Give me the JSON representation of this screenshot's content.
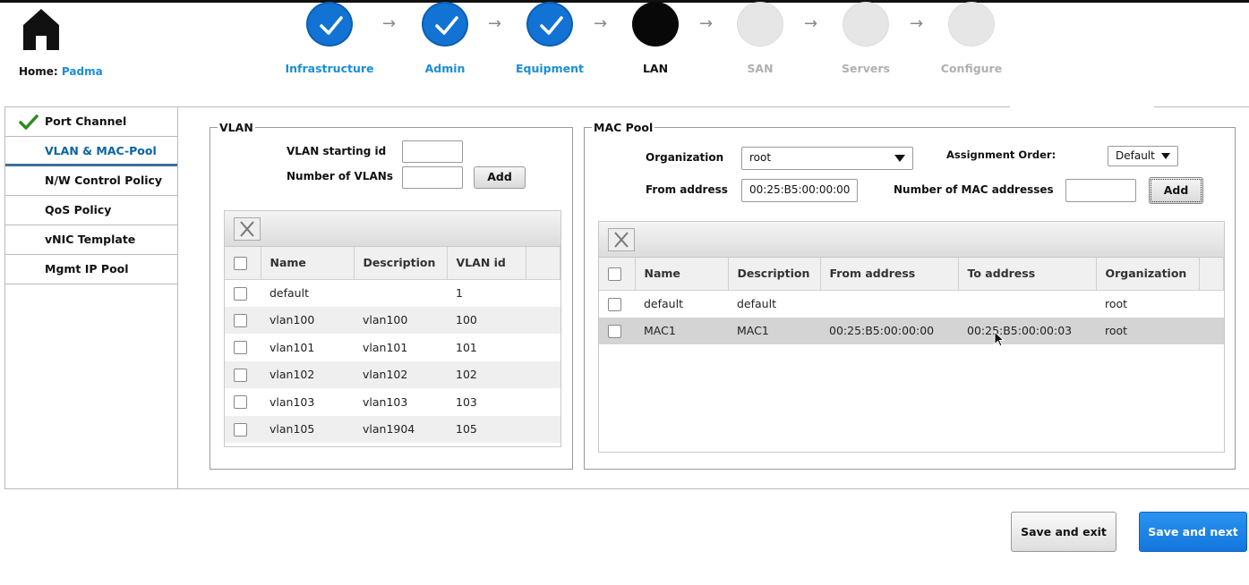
{
  "home": {
    "label": "Home:",
    "user": "Padma"
  },
  "steps": [
    {
      "label": "Infrastructure",
      "state": "done"
    },
    {
      "label": "Admin",
      "state": "done"
    },
    {
      "label": "Equipment",
      "state": "done"
    },
    {
      "label": "LAN",
      "state": "active"
    },
    {
      "label": "SAN",
      "state": "todo"
    },
    {
      "label": "Servers",
      "state": "todo"
    },
    {
      "label": "Configure",
      "state": "todo"
    }
  ],
  "sidebar": {
    "items": [
      {
        "label": "Port Channel",
        "checked": true
      },
      {
        "label": "VLAN & MAC-Pool",
        "selected": true
      },
      {
        "label": "N/W Control Policy"
      },
      {
        "label": "QoS Policy"
      },
      {
        "label": "vNIC Template"
      },
      {
        "label": "Mgmt IP Pool"
      }
    ]
  },
  "vlan": {
    "legend": "VLAN",
    "starting_id_label": "VLAN starting id",
    "starting_id_value": "",
    "count_label": "Number of VLANs",
    "count_value": "",
    "add_label": "Add",
    "columns": [
      "Name",
      "Description",
      "VLAN id"
    ],
    "rows": [
      [
        "default",
        "",
        "1"
      ],
      [
        "vlan100",
        "vlan100",
        "100"
      ],
      [
        "vlan101",
        "vlan101",
        "101"
      ],
      [
        "vlan102",
        "vlan102",
        "102"
      ],
      [
        "vlan103",
        "vlan103",
        "103"
      ],
      [
        "vlan105",
        "vlan1904",
        "105"
      ]
    ]
  },
  "mac": {
    "legend": "MAC Pool",
    "org_label": "Organization",
    "org_value": "root",
    "assign_label": "Assignment Order:",
    "assign_value": "Default",
    "from_label": "From address",
    "from_value": "00:25:B5:00:00:00",
    "count_label": "Number of MAC addresses",
    "count_value": "",
    "add_label": "Add",
    "columns": [
      "Name",
      "Description",
      "From address",
      "To address",
      "Organization"
    ],
    "rows": [
      [
        "default",
        "default",
        "",
        "",
        "root"
      ],
      [
        "MAC1",
        "MAC1",
        "00:25:B5:00:00:00",
        "00:25:B5:00:00:03",
        "root"
      ]
    ]
  },
  "footer": {
    "save_exit": "Save and exit",
    "save_next": "Save and next"
  },
  "colors": {
    "accent": "#1273d4",
    "link": "#1a8dd6",
    "nav_selected": "#0a64a4"
  }
}
